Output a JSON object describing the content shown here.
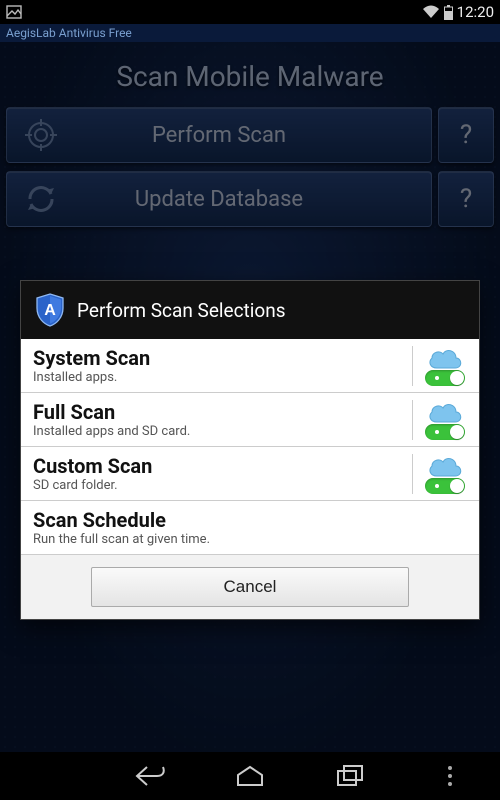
{
  "status": {
    "time": "12:20"
  },
  "app": {
    "name": "AegisLab Antivirus Free"
  },
  "screen": {
    "heading": "Scan Mobile Malware",
    "actions": {
      "scan": "Perform Scan",
      "update": "Update Database",
      "help": "?"
    }
  },
  "dialog": {
    "title": "Perform Scan Selections",
    "options": [
      {
        "title": "System Scan",
        "subtitle": "Installed apps.",
        "toggle": true
      },
      {
        "title": "Full Scan",
        "subtitle": "Installed apps and SD card.",
        "toggle": true
      },
      {
        "title": "Custom Scan",
        "subtitle": "SD card folder.",
        "toggle": true
      },
      {
        "title": "Scan Schedule",
        "subtitle": "Run the full scan at given time.",
        "toggle": false
      }
    ],
    "cancel": "Cancel"
  }
}
